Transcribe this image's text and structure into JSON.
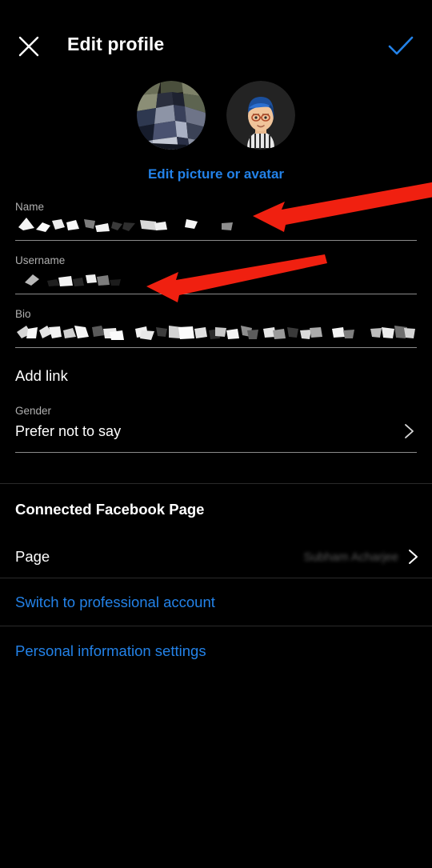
{
  "header": {
    "title": "Edit profile",
    "close_icon": "close-icon",
    "done_icon": "check-icon"
  },
  "avatars": {
    "profile_photo_alt": "profile-photo",
    "cartoon_avatar_alt": "cartoon-avatar",
    "edit_link": "Edit picture or avatar"
  },
  "form": {
    "name": {
      "label": "Name",
      "value": "",
      "redacted": true
    },
    "username": {
      "label": "Username",
      "value": "",
      "redacted": true
    },
    "bio": {
      "label": "Bio",
      "value": "",
      "redacted": true
    },
    "add_link": "Add link",
    "gender": {
      "label": "Gender",
      "value": "Prefer not to say",
      "chevron": "chevron-right-icon"
    }
  },
  "facebook_section": {
    "title": "Connected Facebook Page",
    "page_label": "Page",
    "page_value": "Subham Acharjee",
    "chevron": "chevron-right-icon"
  },
  "links": {
    "switch_professional": "Switch to professional account",
    "personal_info": "Personal information settings"
  },
  "colors": {
    "background": "#000000",
    "accent_blue": "#2382e8",
    "annotation_red": "#f02010",
    "label_grey": "#b0b0b0",
    "divider": "#8a8a8a"
  },
  "annotations": {
    "arrow_name": "red-arrow-pointing-to-name-field",
    "arrow_username": "red-arrow-pointing-to-username-field"
  }
}
